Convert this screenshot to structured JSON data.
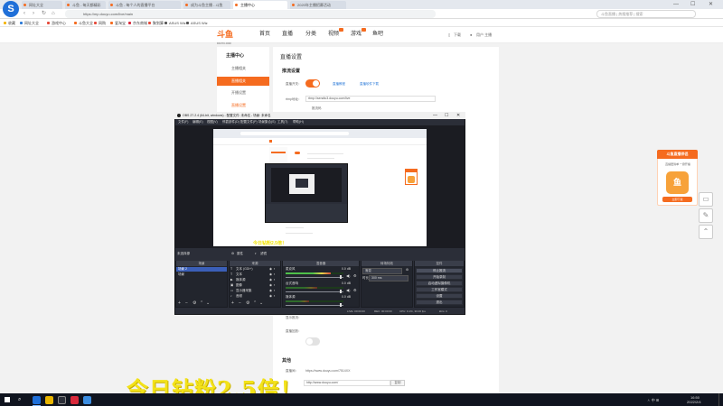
{
  "browser": {
    "logo_letter": "S",
    "tabs": [
      {
        "label": "网址大全",
        "active": false
      },
      {
        "label": "斗鱼 - 每天都精彩",
        "active": false
      },
      {
        "label": "斗鱼 - 每个人的直播平台",
        "active": false
      },
      {
        "label": "成为斗鱼主播 - 斗鱼",
        "active": false
      },
      {
        "label": "主播中心",
        "active": true
      },
      {
        "label": "2020年主播招募活动",
        "active": false
      }
    ],
    "url": "https://mp.douyu.com/live/main",
    "search_placeholder": "斗鱼直播 | 热搜推荐 | 搜索",
    "bookmarks": [
      "收藏",
      "网址大全",
      "游戏中心",
      "斗鱼大全",
      "网购",
      "爱淘宝",
      "京东商城",
      "聚划算",
      "ASUS Wiz",
      "ASUS Wiz"
    ]
  },
  "site": {
    "logo": "斗鱼",
    "logo_sub": "DOUYU.COM",
    "nav": [
      "首页",
      "直播",
      "分类",
      "视频",
      "游戏",
      "鱼吧"
    ],
    "download": "下载",
    "user": "用户 主播"
  },
  "sidebar": {
    "title": "主播中心",
    "items": [
      "主播相关",
      "直播相关"
    ],
    "subitems": [
      "开播设置",
      "直播设置"
    ]
  },
  "main": {
    "title": "直播设置",
    "section_stream": "推流设置",
    "label_enable": "直播开关：",
    "link_1": "直播教程",
    "link_2": "直播软件下载",
    "label_rtmp": "rtmp地址：",
    "rtmp_value": "rtmp://sendtc3.douyu.com/live",
    "label_code": "推流码",
    "label_show": "显示推流：",
    "label_replay": "直播回放：",
    "section_link": "其他",
    "live_link_label": "直播间：",
    "live_link": "https://www.douyu.com/7514XX",
    "link_input": "http://www.douyu.com/",
    "copy_btn": "复制"
  },
  "float_widget": {
    "title": "斗鱼直播伴侣",
    "text": "直播更简单 一键开播",
    "btn": "立即下载",
    "img": "鱼"
  },
  "obs": {
    "title": "OBS 27.2.4 (64-bit, windows) - 配置文件: 未命名 - 场景: 未命名",
    "menu": [
      "文件(F)",
      "编辑(E)",
      "视图(V)",
      "停靠部件(D)",
      "配置文件(P)",
      "场景集合(S)",
      "工具(T)",
      "帮助(H)"
    ],
    "preview_caption": "今日钻粉2.5倍！",
    "lower_title": "未选择源",
    "lower_props": "属性",
    "lower_filters": "滤镜",
    "docks": {
      "scenes": {
        "header": "场景",
        "rows": [
          "场景 2",
          "场景"
        ]
      },
      "sources": {
        "header": "来源",
        "rows": [
          "文本 (GDI+)",
          "文本",
          "媒体源",
          "图像",
          "显示器采集",
          "音频"
        ]
      },
      "mixer": {
        "header": "混音器",
        "channels": [
          {
            "name": "麦克风",
            "db": "0.0 dB",
            "level": 0.78
          },
          {
            "name": "台式音响",
            "db": "0.0 dB",
            "level": 0.55
          },
          {
            "name": "媒体源",
            "db": "0.0 dB",
            "level": 0.4
          }
        ]
      },
      "transitions": {
        "header": "转场特效",
        "type": "渐变",
        "duration_label": "时长",
        "duration": "300 ms"
      },
      "controls": {
        "header": "控件",
        "buttons": [
          "停止推流",
          "开始录制",
          "启动虚拟摄像机",
          "工作室模式",
          "设置",
          "退出"
        ]
      }
    },
    "status": [
      "LIVE: 00:00:00",
      "REC: 00:00:00",
      "CPU: 9.1%, 30.00 fps",
      "kb/s: 0"
    ]
  },
  "overlay": {
    "text": "今日钻粉2.5倍！"
  },
  "taskbar": {
    "time": "16:50",
    "date": "2022/2/4",
    "tray": "ㅅ 中 ⊞"
  }
}
